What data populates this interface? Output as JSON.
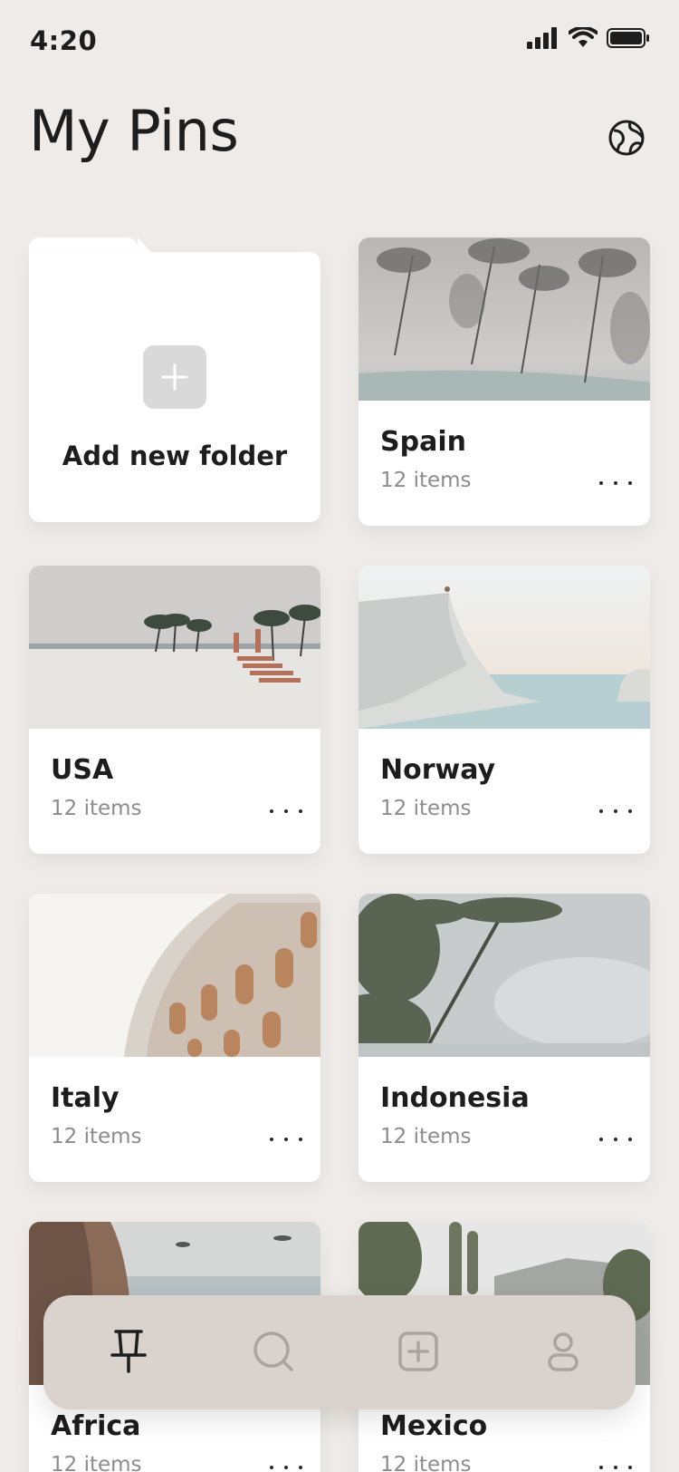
{
  "status_bar": {
    "time": "4:20"
  },
  "header": {
    "title": "My Pins"
  },
  "add_folder": {
    "label": "Add new folder"
  },
  "folders": [
    {
      "name": "Spain",
      "count": "12 items"
    },
    {
      "name": "USA",
      "count": "12 items"
    },
    {
      "name": "Norway",
      "count": "12 items"
    },
    {
      "name": "Italy",
      "count": "12 items"
    },
    {
      "name": "Indonesia",
      "count": "12 items"
    },
    {
      "name": "Africa",
      "count": "12 items"
    },
    {
      "name": "Mexico",
      "count": "12 items"
    }
  ],
  "tab_bar": {
    "items": [
      {
        "icon": "pin-icon",
        "active": true
      },
      {
        "icon": "search-icon",
        "active": false
      },
      {
        "icon": "add-square-icon",
        "active": false
      },
      {
        "icon": "profile-icon",
        "active": false
      }
    ]
  },
  "colors": {
    "background": "#eeebe8",
    "card": "#ffffff",
    "tab_bar": "#d9d2cd",
    "muted_text": "#8c8c8c",
    "inactive_icon": "#a9a4a0"
  }
}
